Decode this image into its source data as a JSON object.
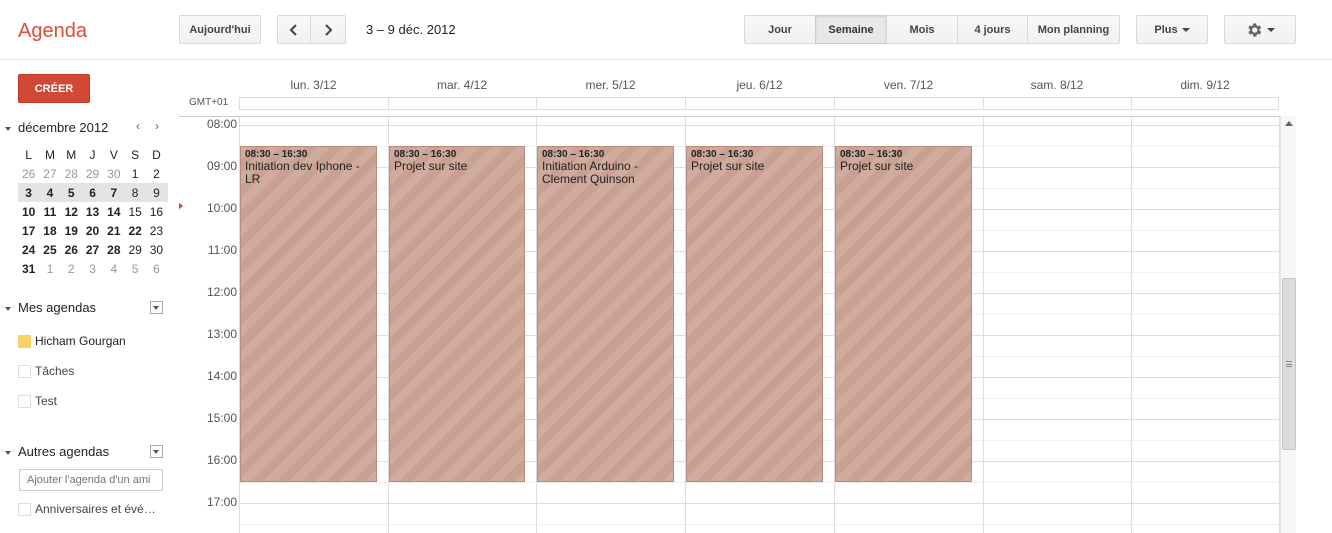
{
  "header": {
    "logo": "Agenda",
    "today_btn": "Aujourd'hui",
    "date_range": "3 – 9 déc. 2012",
    "views": [
      "Jour",
      "Semaine",
      "Mois",
      "4 jours",
      "Mon planning"
    ],
    "active_view": "Semaine",
    "more_btn": "Plus"
  },
  "sidebar": {
    "create_btn": "CRÉER",
    "mini_cal": {
      "title": "décembre 2012",
      "dow": [
        "L",
        "M",
        "M",
        "J",
        "V",
        "S",
        "D"
      ],
      "weeks": [
        [
          "26",
          "27",
          "28",
          "29",
          "30",
          "1",
          "2"
        ],
        [
          "3",
          "4",
          "5",
          "6",
          "7",
          "8",
          "9"
        ],
        [
          "10",
          "11",
          "12",
          "13",
          "14",
          "15",
          "16"
        ],
        [
          "17",
          "18",
          "19",
          "20",
          "21",
          "22",
          "23"
        ],
        [
          "24",
          "25",
          "26",
          "27",
          "28",
          "29",
          "30"
        ],
        [
          "31",
          "1",
          "2",
          "3",
          "4",
          "5",
          "6"
        ]
      ]
    },
    "my_cals_label": "Mes agendas",
    "my_cals": [
      {
        "name": "Hicham Gourgan",
        "color": "#fad165"
      },
      {
        "name": "Tâches",
        "color": ""
      },
      {
        "name": "Test",
        "color": ""
      }
    ],
    "other_cals_label": "Autres agendas",
    "add_placeholder": "Ajouter l'agenda d'un ami",
    "other_cals": [
      {
        "name": "Anniversaires et évé…"
      }
    ]
  },
  "grid": {
    "timezone": "GMT+01",
    "days": [
      "lun. 3/12",
      "mar. 4/12",
      "mer. 5/12",
      "jeu. 6/12",
      "ven. 7/12",
      "sam. 8/12",
      "dim. 9/12"
    ],
    "hours": [
      "08:00",
      "09:00",
      "10:00",
      "11:00",
      "12:00",
      "13:00",
      "14:00",
      "15:00",
      "16:00",
      "17:00"
    ],
    "events": [
      {
        "day": 0,
        "start": "08:30",
        "end": "16:30",
        "time": "08:30 – 16:30",
        "title": "Initiation dev Iphone - LR"
      },
      {
        "day": 1,
        "start": "08:30",
        "end": "16:30",
        "time": "08:30 – 16:30",
        "title": "Projet sur site"
      },
      {
        "day": 2,
        "start": "08:30",
        "end": "16:30",
        "time": "08:30 – 16:30",
        "title": "Initiation Arduino - Clement Quinson"
      },
      {
        "day": 3,
        "start": "08:30",
        "end": "16:30",
        "time": "08:30 – 16:30",
        "title": "Projet sur site"
      },
      {
        "day": 4,
        "start": "08:30",
        "end": "16:30",
        "time": "08:30 – 16:30",
        "title": "Projet sur site"
      }
    ],
    "event_color": "#c9a091"
  }
}
